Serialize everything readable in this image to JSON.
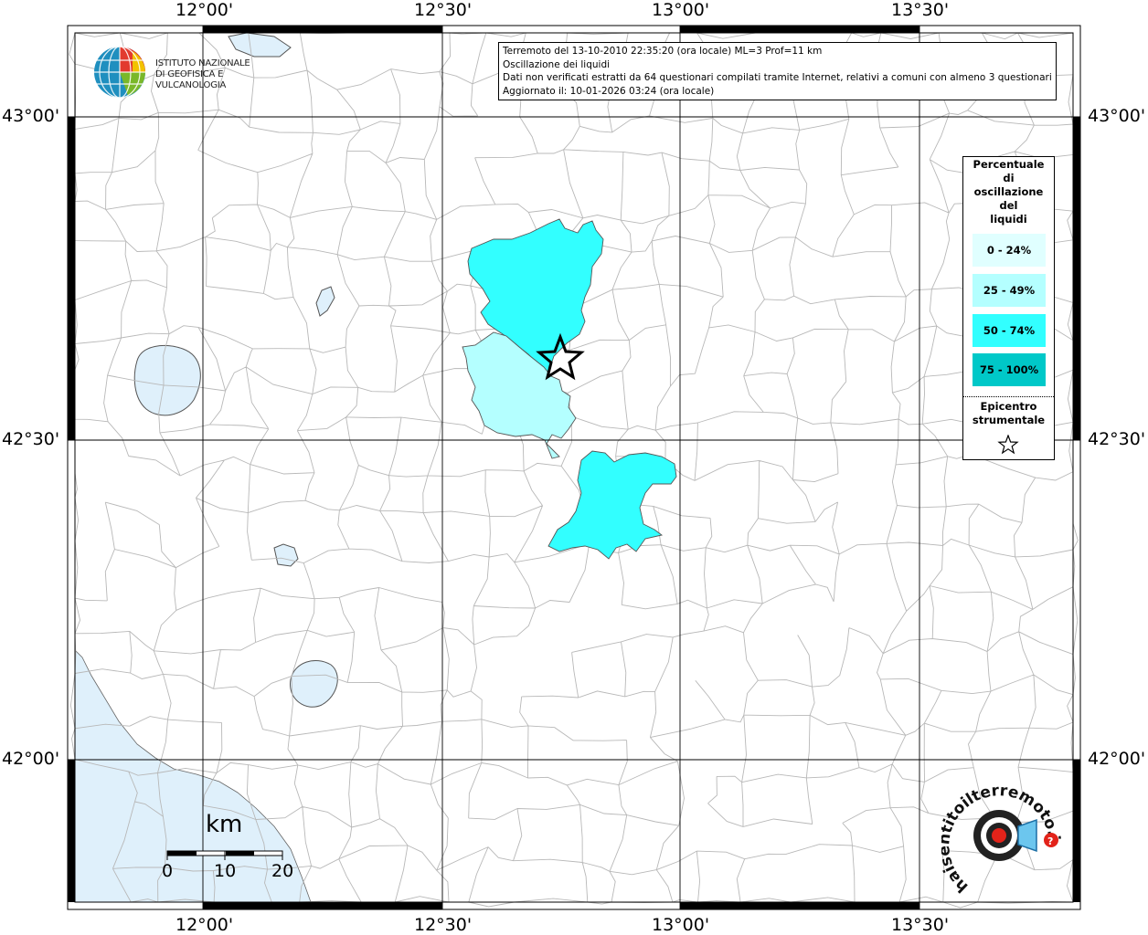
{
  "info": {
    "line1": "Terremoto del 13-10-2010 22:35:20 (ora locale) ML=3 Prof=11 km",
    "line2": "Oscillazione dei liquidi",
    "line3": "Dati non verificati estratti da 64 questionari compilati tramite Internet, relativi a comuni con almeno 3 questionari.",
    "line4": "Aggiornato il: 10-01-2026 03:24 (ora locale)"
  },
  "logo": {
    "line1": "ISTITUTO NAZIONALE",
    "line2": "DI GEOFISICA E VULCANOLOGIA",
    "watermark": "haisentitoilterremoto.it www."
  },
  "axes": {
    "top": [
      "12°00'",
      "12°30'",
      "13°00'",
      "13°30'"
    ],
    "bottom": [
      "12°00'",
      "12°30'",
      "13°00'",
      "13°30'"
    ],
    "left": [
      "43°00'",
      "42°30'",
      "42°00'"
    ],
    "right": [
      "43°00'",
      "42°30'",
      "42°00'"
    ]
  },
  "legend": {
    "title": [
      "Percentuale",
      "di",
      "oscillazione",
      "del",
      "liquidi"
    ],
    "classes": [
      {
        "label": "0 - 24%",
        "color": "#e0ffff"
      },
      {
        "label": "25 - 49%",
        "color": "#b4ffff"
      },
      {
        "label": "50 - 74%",
        "color": "#32ffff"
      },
      {
        "label": "75 - 100%",
        "color": "#00c8c8"
      }
    ],
    "epicenter": [
      "Epicentro",
      "strumentale"
    ],
    "star": "☆"
  },
  "scale": {
    "unit": "km",
    "ticks": [
      "0",
      "10",
      "20"
    ]
  },
  "colors": {
    "sea": "#dff0fb",
    "lake": "#dff0fb",
    "boundary": "#b8b8b8",
    "grid": "#000000",
    "class_50_74": "#32ffff",
    "class_25_49": "#b4ffff"
  },
  "regions": [
    {
      "name": "northern-municipality",
      "class": "50 - 74%"
    },
    {
      "name": "central-municipality",
      "class": "25 - 49%"
    },
    {
      "name": "southern-municipality",
      "class": "50 - 74%"
    }
  ]
}
